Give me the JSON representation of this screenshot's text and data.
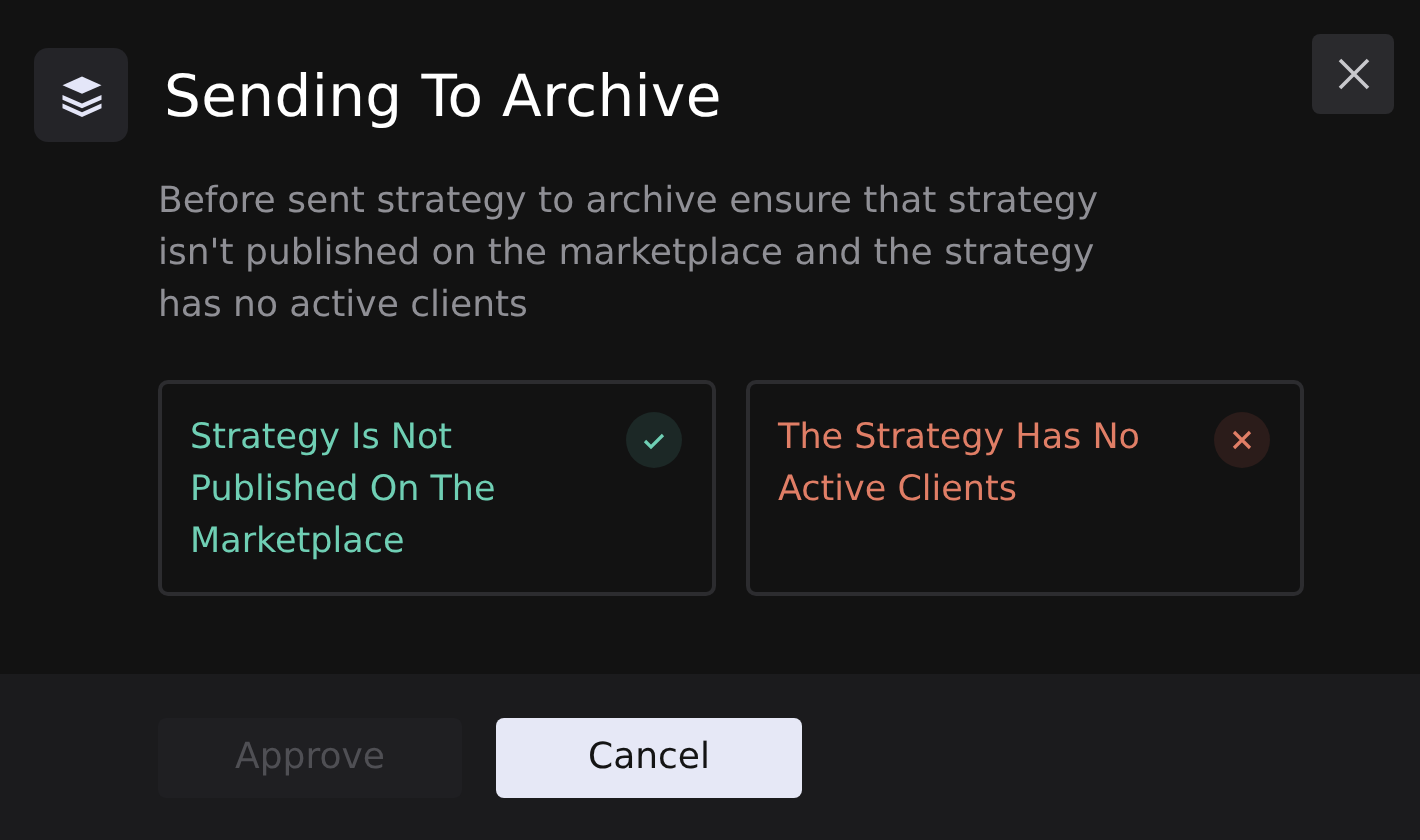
{
  "dialog": {
    "title": "Sending To Archive",
    "description": "Before sent strategy to archive ensure that strategy isn't published on the marketplace and the strategy has no active clients"
  },
  "conditions": [
    {
      "label": "Strategy Is Not Published On The Marketplace",
      "met": true
    },
    {
      "label": "The Strategy Has No Active Clients",
      "met": false
    }
  ],
  "buttons": [
    {
      "label": "Approve",
      "kind": "primary",
      "disabled": true
    },
    {
      "label": "Cancel",
      "kind": "secondary",
      "disabled": false
    }
  ]
}
